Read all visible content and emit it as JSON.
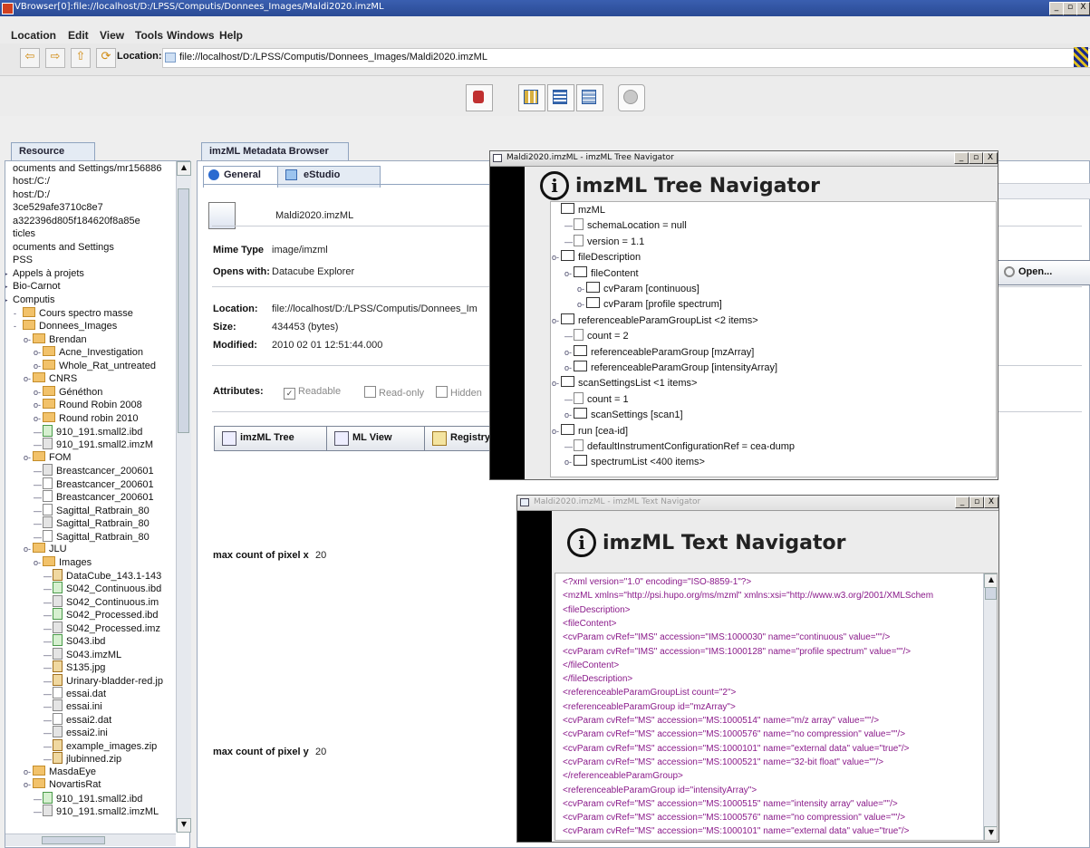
{
  "window": {
    "title": "VBrowser[0]:file://localhost/D:/LPSS/Computis/Donnees_Images/Maldi2020.imzML",
    "controls": [
      "_",
      "▫",
      "X"
    ]
  },
  "menu": [
    "Location",
    "Edit",
    "View",
    "Tools",
    "Windows",
    "Help"
  ],
  "location": {
    "label": "Location:",
    "url": "file://localhost/D:/LPSS/Computis/Donnees_Images/Maldi2020.imzML"
  },
  "resource_panel": {
    "tab": "Resource",
    "rows": [
      {
        "text": "ocuments and Settings/mr156886",
        "type": "none"
      },
      {
        "text": "host:/C:/",
        "type": "none"
      },
      {
        "text": "host:/D:/",
        "type": "none"
      },
      {
        "text": "3ce529afe3710c8e7",
        "type": "none"
      },
      {
        "text": "a322396d805f184620f8a85e",
        "type": "none"
      },
      {
        "text": "ticles",
        "type": "none"
      },
      {
        "text": "ocuments and Settings",
        "type": "none"
      },
      {
        "text": "PSS",
        "type": "none"
      },
      {
        "text": "Appels à projets",
        "type": "none"
      },
      {
        "text": "Bio-Carnot",
        "type": "none"
      },
      {
        "text": "Computis",
        "type": "none"
      },
      {
        "text": "Cours spectro masse",
        "type": "folder"
      },
      {
        "text": "Donnees_Images",
        "type": "folder"
      },
      {
        "text": "Brendan",
        "type": "folder"
      },
      {
        "text": "Acne_Investigation",
        "type": "folder"
      },
      {
        "text": "Whole_Rat_untreated",
        "type": "folder"
      },
      {
        "text": "CNRS",
        "type": "folder"
      },
      {
        "text": "Généthon",
        "type": "folder"
      },
      {
        "text": "Round Robin 2008",
        "type": "folder"
      },
      {
        "text": "Round robin 2010",
        "type": "folder"
      },
      {
        "text": "910_191.small2.ibd",
        "type": "g"
      },
      {
        "text": "910_191.small2.imzM",
        "type": "gr"
      },
      {
        "text": "FOM",
        "type": "folder"
      },
      {
        "text": "Breastcancer_200601",
        "type": "gr"
      },
      {
        "text": "Breastcancer_200601",
        "type": "file"
      },
      {
        "text": "Breastcancer_200601",
        "type": "file"
      },
      {
        "text": "Sagittal_Ratbrain_80",
        "type": "file"
      },
      {
        "text": "Sagittal_Ratbrain_80",
        "type": "gr"
      },
      {
        "text": "Sagittal_Ratbrain_80",
        "type": "file"
      },
      {
        "text": "JLU",
        "type": "folder"
      },
      {
        "text": "Images",
        "type": "folder"
      },
      {
        "text": "DataCube_143.1-143",
        "type": "z"
      },
      {
        "text": "S042_Continuous.ibd",
        "type": "g"
      },
      {
        "text": "S042_Continuous.im",
        "type": "gr"
      },
      {
        "text": "S042_Processed.ibd",
        "type": "g"
      },
      {
        "text": "S042_Processed.imz",
        "type": "gr"
      },
      {
        "text": "S043.ibd",
        "type": "g"
      },
      {
        "text": "S043.imzML",
        "type": "gr"
      },
      {
        "text": "S135.jpg",
        "type": "z"
      },
      {
        "text": "Urinary-bladder-red.jp",
        "type": "z"
      },
      {
        "text": "essai.dat",
        "type": "file"
      },
      {
        "text": "essai.ini",
        "type": "gr"
      },
      {
        "text": "essai2.dat",
        "type": "file"
      },
      {
        "text": "essai2.ini",
        "type": "gr"
      },
      {
        "text": "example_images.zip",
        "type": "z"
      },
      {
        "text": "jlubinned.zip",
        "type": "z"
      },
      {
        "text": "MasdaEye",
        "type": "folder"
      },
      {
        "text": "NovartisRat",
        "type": "folder"
      },
      {
        "text": "910_191.small2.ibd",
        "type": "g"
      },
      {
        "text": "910_191.small2.imzML",
        "type": "gr"
      }
    ]
  },
  "metadata": {
    "tab": "imzML Metadata Browser",
    "subtabs": [
      "General",
      "eStudio"
    ],
    "filename": "Maldi2020.imzML",
    "mime_label": "Mime Type",
    "mime_value": "image/imzml",
    "opens_label": "Opens with:",
    "opens_value": "Datacube Explorer",
    "open_button": "Open...",
    "location_label": "Location:",
    "location_value": "file://localhost/D:/LPSS/Computis/Donnees_Im",
    "size_label": "Size:",
    "size_value": "434453 (bytes)",
    "modified_label": "Modified:",
    "modified_value": "2010 02 01 12:51:44.000",
    "attributes_label": "Attributes:",
    "readable": "Readable",
    "readonly": "Read-only",
    "hidden": "Hidden",
    "buttons": [
      "imzML Tree",
      "ML View",
      "Registry"
    ],
    "pixel_x_label": "max count of pixel x",
    "pixel_x_value": "20",
    "pixel_y_label": "max count of pixel y",
    "pixel_y_value": "20"
  },
  "tree_navigator": {
    "window_title": "Maldi2020.imzML - imzML Tree Navigator",
    "heading": "imzML Tree Navigator",
    "nodes": [
      {
        "text": "mzML",
        "depth": 0,
        "kind": "folder",
        "knob": ""
      },
      {
        "text": "schemaLocation = null",
        "depth": 1,
        "kind": "file",
        "knob": ""
      },
      {
        "text": "version = 1.1",
        "depth": 1,
        "kind": "file",
        "knob": ""
      },
      {
        "text": "fileDescription",
        "depth": 0,
        "kind": "folder",
        "knob": "o-"
      },
      {
        "text": "fileContent",
        "depth": 1,
        "kind": "folder",
        "knob": "o-"
      },
      {
        "text": "cvParam [continuous]",
        "depth": 2,
        "kind": "folder",
        "knob": "o-"
      },
      {
        "text": "cvParam [profile spectrum]",
        "depth": 2,
        "kind": "folder",
        "knob": "o-"
      },
      {
        "text": "referenceableParamGroupList <2 items>",
        "depth": 0,
        "kind": "folder",
        "knob": "o-"
      },
      {
        "text": "count = 2",
        "depth": 1,
        "kind": "file",
        "knob": ""
      },
      {
        "text": "referenceableParamGroup [mzArray]",
        "depth": 1,
        "kind": "folder",
        "knob": "o-"
      },
      {
        "text": "referenceableParamGroup [intensityArray]",
        "depth": 1,
        "kind": "folder",
        "knob": "o-"
      },
      {
        "text": "scanSettingsList <1 items>",
        "depth": 0,
        "kind": "folder",
        "knob": "o-"
      },
      {
        "text": "count = 1",
        "depth": 1,
        "kind": "file",
        "knob": ""
      },
      {
        "text": "scanSettings [scan1]",
        "depth": 1,
        "kind": "folder",
        "knob": "o-"
      },
      {
        "text": "run [cea-id]",
        "depth": 0,
        "kind": "folder",
        "knob": "o-"
      },
      {
        "text": "defaultInstrumentConfigurationRef = cea-dump",
        "depth": 1,
        "kind": "file",
        "knob": ""
      },
      {
        "text": "spectrumList <400 items>",
        "depth": 1,
        "kind": "folder",
        "knob": "o-"
      }
    ]
  },
  "text_navigator": {
    "window_title": "Maldi2020.imzML - imzML Text Navigator",
    "heading": "imzML Text Navigator",
    "lines": [
      "<?xml version=\"1.0\" encoding=\"ISO-8859-1\"?>",
      "<mzML xmlns=\"http://psi.hupo.org/ms/mzml\" xmlns:xsi=\"http://www.w3.org/2001/XMLSchem",
      "<fileDescription>",
      "<fileContent>",
      "<cvParam cvRef=\"IMS\" accession=\"IMS:1000030\" name=\"continuous\" value=\"\"/>",
      "<cvParam cvRef=\"IMS\" accession=\"IMS:1000128\" name=\"profile spectrum\" value=\"\"/>",
      "</fileContent>",
      "</fileDescription>",
      "<referenceableParamGroupList count=\"2\">",
      "<referenceableParamGroup id=\"mzArray\">",
      "<cvParam cvRef=\"MS\" accession=\"MS:1000514\" name=\"m/z array\" value=\"\"/>",
      "<cvParam cvRef=\"MS\" accession=\"MS:1000576\" name=\"no compression\" value=\"\"/>",
      "<cvParam cvRef=\"MS\" accession=\"MS:1000101\" name=\"external data\" value=\"true\"/>",
      "<cvParam cvRef=\"MS\" accession=\"MS:1000521\" name=\"32-bit float\" value=\"\"/>",
      "</referenceableParamGroup>",
      "<referenceableParamGroup id=\"intensityArray\">",
      "<cvParam cvRef=\"MS\" accession=\"MS:1000515\" name=\"intensity array\" value=\"\"/>",
      "<cvParam cvRef=\"MS\" accession=\"MS:1000576\" name=\"no compression\" value=\"\"/>",
      "<cvParam cvRef=\"MS\" accession=\"MS:1000101\" name=\"external data\" value=\"true\"/>"
    ]
  }
}
